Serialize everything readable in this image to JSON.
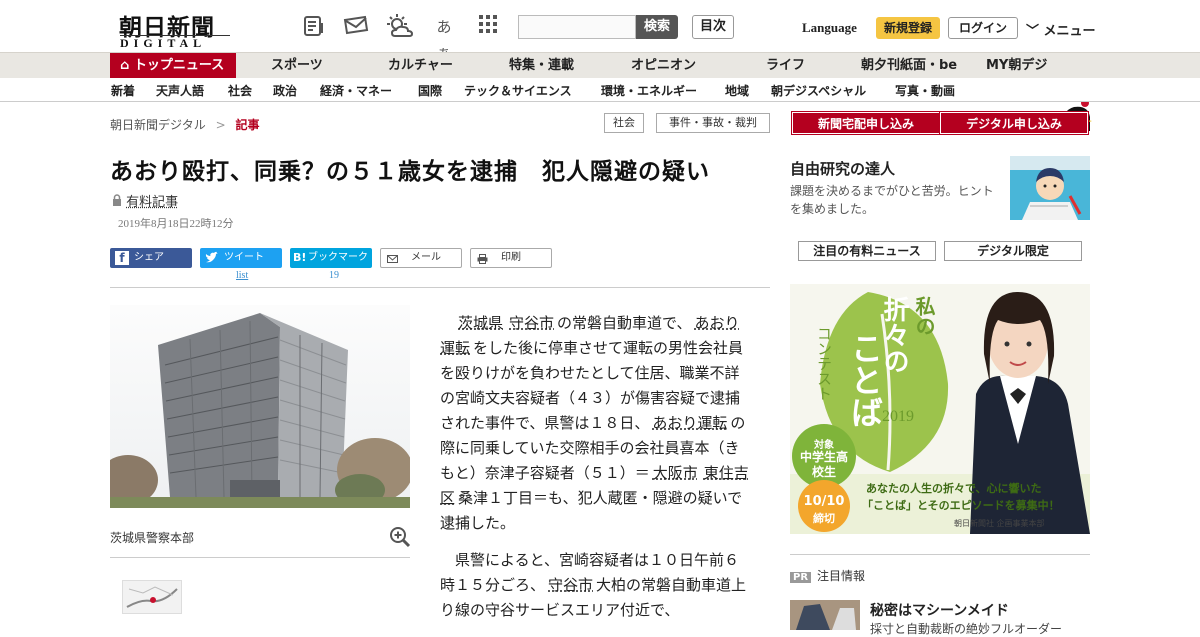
{
  "header": {
    "logo_text": "朝日新聞",
    "logo_sub": "DIGITAL",
    "icons": [
      "paper-icon",
      "mail-ticket-icon",
      "weather-icon",
      "font-size-icon",
      "apps-grid-icon"
    ],
    "font_icon_text": "あぁ",
    "search_button": "検索",
    "toc_button": "目次",
    "language": "Language",
    "register": "新規登録",
    "login": "ログイン",
    "menu": "メニュー"
  },
  "nav_primary": [
    "トップニュース",
    "スポーツ",
    "カルチャー",
    "特集・連載",
    "オピニオン",
    "ライフ",
    "朝夕刊紙面・be",
    "MY朝デジ"
  ],
  "nav_secondary": [
    "新着",
    "天声人語",
    "社会",
    "政治",
    "経済・マネー",
    "国際",
    "テック＆サイエンス",
    "環境・エネルギー",
    "地域",
    "朝デジスペシャル",
    "写真・動画"
  ],
  "breadcrumb": {
    "home": "朝日新聞デジタル",
    "sep": ">",
    "current": "記事"
  },
  "tags": [
    "社会",
    "事件・事故・裁判"
  ],
  "article": {
    "title": "あおり殴打、同乗？の５１歳女を逮捕　犯人隠避の疑い",
    "paid_label": "有料記事",
    "date": "2019年8月18日22時12分",
    "share": {
      "facebook": "シェア",
      "twitter": "ツイート",
      "twitter_count": "list",
      "hatena": "ブックマーク",
      "hatena_count": "19",
      "mail": "メール",
      "print": "印刷"
    },
    "caption": "茨城県警察本部",
    "p1": {
      "s1": "茨城県",
      "s2": "守谷市",
      "s3": "の常磐自動車道で、",
      "s4": "あおり運転",
      "s5": "をした後に停車させて運転の男性会社員を殴りけがを負わせたとして住居、職業不詳の宮崎文夫容疑者（４３）が傷害容疑で逮捕された事件で、県警は１８日、",
      "s6": "あおり運転",
      "s7": "の際に同乗していた交際相手の会社員喜本（きもと）奈津子容疑者（５１）＝",
      "s8": "大阪市",
      "s9": "東住吉区",
      "s10": "桑津１丁目＝も、犯人蔵匿・隠避の疑いで逮捕した。"
    },
    "p2": {
      "s1": "県警によると、宮崎容疑者は１０日午前６時１５分ごろ、",
      "s2": "守谷市",
      "s3": "大柏の常磐自動車道上り線の守谷サービスエリア付近で、"
    }
  },
  "sidebar": {
    "subscribe_paper": "新聞宅配申し込み",
    "subscribe_digital": "デジタル申し込み",
    "feature_title": "自由研究の達人",
    "feature_desc": "課題を決めるまでがひと苦労。ヒントを集めました。",
    "tab_paid": "注目の有料ニュース",
    "tab_digital": "デジタル限定",
    "banner": {
      "kicker": "私の",
      "title1": "折々の",
      "title2": "ことば",
      "contest": "コンテスト",
      "year": "2019",
      "target_label": "対象",
      "target": "中学生高校生",
      "deadline_date": "10/10",
      "deadline": "締切",
      "slogan1": "あなたの人生の折々で、心に響いた",
      "slogan2": "「ことば」とそのエピソードを募集中！",
      "sponsor": "朝日新聞社 企画事業本部"
    },
    "pr_badge": "PR",
    "pr_label": "注目情報",
    "pr_title": "秘密はマシーンメイド",
    "pr_sub": "採寸と自動裁断の絶妙フルオーダー"
  },
  "colors": {
    "brand_red": "#b4001f",
    "nav_bg": "#e9e7e2",
    "register_yellow": "#f5c542",
    "facebook": "#3b5998",
    "twitter": "#1da1f2",
    "hatena": "#00a4de",
    "banner_green": "#8dbb3c"
  }
}
